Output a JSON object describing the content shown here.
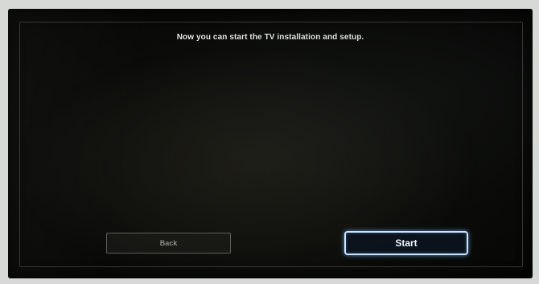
{
  "screen": {
    "message": "Now you can start the TV installation and setup."
  },
  "buttons": {
    "back_label": "Back",
    "start_label": "Start",
    "focused": "start"
  },
  "colors": {
    "background": "#0b0c09",
    "text": "#e4e6e0",
    "focus_outline": "#c8e4ff",
    "inactive_button_text": "#8d8f88"
  }
}
